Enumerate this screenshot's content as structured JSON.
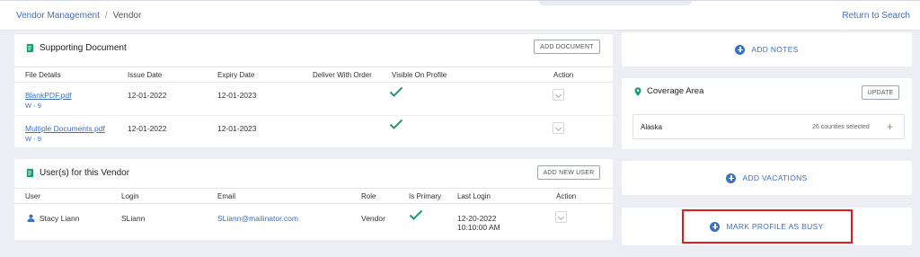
{
  "breadcrumb": {
    "parent": "Vendor Management",
    "separator": "/",
    "current": "Vendor"
  },
  "return_link": "Return to Search",
  "documents": {
    "title": "Supporting Document",
    "add_button": "ADD DOCUMENT",
    "columns": [
      "File Details",
      "Issue Date",
      "Expiry Date",
      "Deliver With Order",
      "Visible On Profile",
      "Action"
    ],
    "rows": [
      {
        "file": "BlankPDF.pdf",
        "type": "W - 9",
        "issue": "12-01-2022",
        "expiry": "12-01-2023",
        "visible": true
      },
      {
        "file": "Multiple Documents.pdf",
        "type": "W - 9",
        "issue": "12-01-2022",
        "expiry": "12-01-2023",
        "visible": true
      }
    ]
  },
  "users": {
    "title": "User(s) for this Vendor",
    "add_button": "ADD NEW USER",
    "columns": [
      "User",
      "Login",
      "Email",
      "Role",
      "Is Primary",
      "Last Login",
      "Action"
    ],
    "rows": [
      {
        "name": "Stacy Liann",
        "login": "SLiann",
        "email": "SLiann@mailinator.com",
        "role": "Vendor",
        "primary": true,
        "last_login_date": "12-20-2022",
        "last_login_time": "10:10:00 AM"
      }
    ]
  },
  "side": {
    "add_notes": "ADD NOTES",
    "coverage": {
      "title": "Coverage Area",
      "update_button": "UPDATE",
      "state": "Alaska",
      "counties": "26 counties selected",
      "expand_symbol": "+"
    },
    "add_vacations": "ADD VACATIONS",
    "mark_busy": "MARK PROFILE AS BUSY"
  },
  "colors": {
    "accent": "#3a6fc4",
    "check": "#1e9a6c",
    "highlight": "#e21c1c"
  },
  "icons": [
    "document-icon",
    "user-icon",
    "check-icon",
    "plus-circle-icon",
    "location-pin-icon"
  ]
}
